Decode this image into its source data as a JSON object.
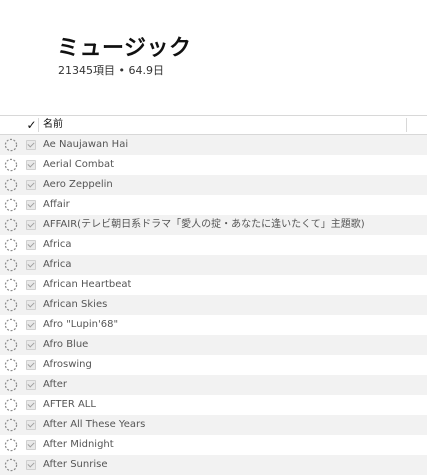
{
  "library": {
    "title": "ミュージック",
    "summary": "21345項目 • 64.9日"
  },
  "table": {
    "header": {
      "check_glyph": "✓",
      "name_label": "名前"
    },
    "rows": [
      {
        "name": "Ae Naujawan Hai",
        "checked": true,
        "status_icon": "dashed-circle-icon"
      },
      {
        "name": "Aerial Combat",
        "checked": true,
        "status_icon": "dashed-circle-icon"
      },
      {
        "name": "Aero Zeppelin",
        "checked": true,
        "status_icon": "dashed-circle-icon"
      },
      {
        "name": "Affair",
        "checked": true,
        "status_icon": "dashed-circle-icon"
      },
      {
        "name": "AFFAIR(テレビ朝日系ドラマ「愛人の掟・あなたに逢いたくて」主題歌)",
        "checked": true,
        "status_icon": "dashed-circle-icon"
      },
      {
        "name": "Africa",
        "checked": true,
        "status_icon": "dashed-circle-icon"
      },
      {
        "name": "Africa",
        "checked": true,
        "status_icon": "dashed-circle-icon"
      },
      {
        "name": "African Heartbeat",
        "checked": true,
        "status_icon": "dashed-circle-icon"
      },
      {
        "name": "African Skies",
        "checked": true,
        "status_icon": "dashed-circle-icon"
      },
      {
        "name": "Afro \"Lupin'68\"",
        "checked": true,
        "status_icon": "dashed-circle-icon"
      },
      {
        "name": "Afro Blue",
        "checked": true,
        "status_icon": "dashed-circle-icon"
      },
      {
        "name": "Afroswing",
        "checked": true,
        "status_icon": "dashed-circle-icon"
      },
      {
        "name": "After",
        "checked": true,
        "status_icon": "dashed-circle-icon"
      },
      {
        "name": "AFTER ALL",
        "checked": true,
        "status_icon": "dashed-circle-icon"
      },
      {
        "name": "After All These Years",
        "checked": true,
        "status_icon": "dashed-circle-icon"
      },
      {
        "name": "After Midnight",
        "checked": true,
        "status_icon": "dashed-circle-icon"
      },
      {
        "name": "After Sunrise",
        "checked": true,
        "status_icon": "dashed-circle-icon"
      }
    ]
  },
  "colors": {
    "row_alt": "#f2f2f2",
    "row_base": "#ffffff",
    "grid_line": "#d8d8d8",
    "text_primary": "#111111",
    "text_secondary": "#555555"
  }
}
